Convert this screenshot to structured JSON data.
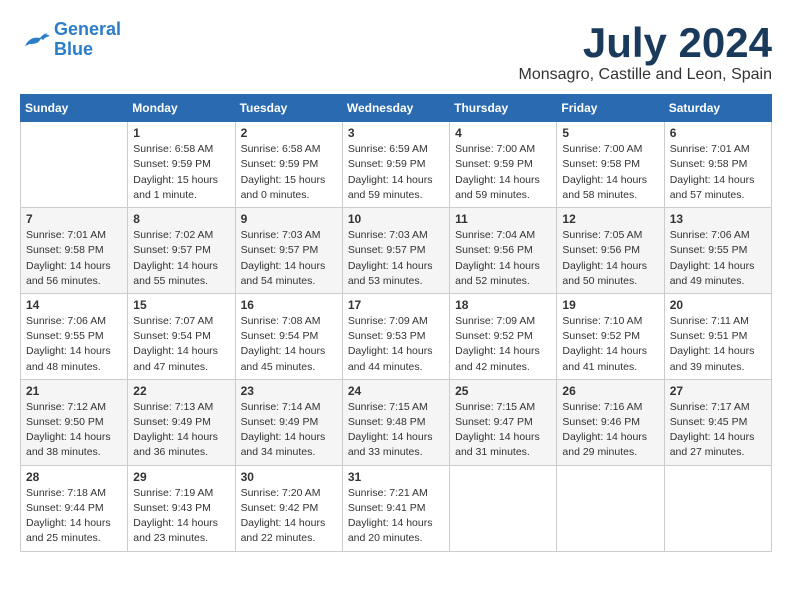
{
  "logo": {
    "line1": "General",
    "line2": "Blue"
  },
  "title": "July 2024",
  "location": "Monsagro, Castille and Leon, Spain",
  "weekdays": [
    "Sunday",
    "Monday",
    "Tuesday",
    "Wednesday",
    "Thursday",
    "Friday",
    "Saturday"
  ],
  "weeks": [
    [
      {
        "day": "",
        "info": ""
      },
      {
        "day": "1",
        "info": "Sunrise: 6:58 AM\nSunset: 9:59 PM\nDaylight: 15 hours\nand 1 minute."
      },
      {
        "day": "2",
        "info": "Sunrise: 6:58 AM\nSunset: 9:59 PM\nDaylight: 15 hours\nand 0 minutes."
      },
      {
        "day": "3",
        "info": "Sunrise: 6:59 AM\nSunset: 9:59 PM\nDaylight: 14 hours\nand 59 minutes."
      },
      {
        "day": "4",
        "info": "Sunrise: 7:00 AM\nSunset: 9:59 PM\nDaylight: 14 hours\nand 59 minutes."
      },
      {
        "day": "5",
        "info": "Sunrise: 7:00 AM\nSunset: 9:58 PM\nDaylight: 14 hours\nand 58 minutes."
      },
      {
        "day": "6",
        "info": "Sunrise: 7:01 AM\nSunset: 9:58 PM\nDaylight: 14 hours\nand 57 minutes."
      }
    ],
    [
      {
        "day": "7",
        "info": "Sunrise: 7:01 AM\nSunset: 9:58 PM\nDaylight: 14 hours\nand 56 minutes."
      },
      {
        "day": "8",
        "info": "Sunrise: 7:02 AM\nSunset: 9:57 PM\nDaylight: 14 hours\nand 55 minutes."
      },
      {
        "day": "9",
        "info": "Sunrise: 7:03 AM\nSunset: 9:57 PM\nDaylight: 14 hours\nand 54 minutes."
      },
      {
        "day": "10",
        "info": "Sunrise: 7:03 AM\nSunset: 9:57 PM\nDaylight: 14 hours\nand 53 minutes."
      },
      {
        "day": "11",
        "info": "Sunrise: 7:04 AM\nSunset: 9:56 PM\nDaylight: 14 hours\nand 52 minutes."
      },
      {
        "day": "12",
        "info": "Sunrise: 7:05 AM\nSunset: 9:56 PM\nDaylight: 14 hours\nand 50 minutes."
      },
      {
        "day": "13",
        "info": "Sunrise: 7:06 AM\nSunset: 9:55 PM\nDaylight: 14 hours\nand 49 minutes."
      }
    ],
    [
      {
        "day": "14",
        "info": "Sunrise: 7:06 AM\nSunset: 9:55 PM\nDaylight: 14 hours\nand 48 minutes."
      },
      {
        "day": "15",
        "info": "Sunrise: 7:07 AM\nSunset: 9:54 PM\nDaylight: 14 hours\nand 47 minutes."
      },
      {
        "day": "16",
        "info": "Sunrise: 7:08 AM\nSunset: 9:54 PM\nDaylight: 14 hours\nand 45 minutes."
      },
      {
        "day": "17",
        "info": "Sunrise: 7:09 AM\nSunset: 9:53 PM\nDaylight: 14 hours\nand 44 minutes."
      },
      {
        "day": "18",
        "info": "Sunrise: 7:09 AM\nSunset: 9:52 PM\nDaylight: 14 hours\nand 42 minutes."
      },
      {
        "day": "19",
        "info": "Sunrise: 7:10 AM\nSunset: 9:52 PM\nDaylight: 14 hours\nand 41 minutes."
      },
      {
        "day": "20",
        "info": "Sunrise: 7:11 AM\nSunset: 9:51 PM\nDaylight: 14 hours\nand 39 minutes."
      }
    ],
    [
      {
        "day": "21",
        "info": "Sunrise: 7:12 AM\nSunset: 9:50 PM\nDaylight: 14 hours\nand 38 minutes."
      },
      {
        "day": "22",
        "info": "Sunrise: 7:13 AM\nSunset: 9:49 PM\nDaylight: 14 hours\nand 36 minutes."
      },
      {
        "day": "23",
        "info": "Sunrise: 7:14 AM\nSunset: 9:49 PM\nDaylight: 14 hours\nand 34 minutes."
      },
      {
        "day": "24",
        "info": "Sunrise: 7:15 AM\nSunset: 9:48 PM\nDaylight: 14 hours\nand 33 minutes."
      },
      {
        "day": "25",
        "info": "Sunrise: 7:15 AM\nSunset: 9:47 PM\nDaylight: 14 hours\nand 31 minutes."
      },
      {
        "day": "26",
        "info": "Sunrise: 7:16 AM\nSunset: 9:46 PM\nDaylight: 14 hours\nand 29 minutes."
      },
      {
        "day": "27",
        "info": "Sunrise: 7:17 AM\nSunset: 9:45 PM\nDaylight: 14 hours\nand 27 minutes."
      }
    ],
    [
      {
        "day": "28",
        "info": "Sunrise: 7:18 AM\nSunset: 9:44 PM\nDaylight: 14 hours\nand 25 minutes."
      },
      {
        "day": "29",
        "info": "Sunrise: 7:19 AM\nSunset: 9:43 PM\nDaylight: 14 hours\nand 23 minutes."
      },
      {
        "day": "30",
        "info": "Sunrise: 7:20 AM\nSunset: 9:42 PM\nDaylight: 14 hours\nand 22 minutes."
      },
      {
        "day": "31",
        "info": "Sunrise: 7:21 AM\nSunset: 9:41 PM\nDaylight: 14 hours\nand 20 minutes."
      },
      {
        "day": "",
        "info": ""
      },
      {
        "day": "",
        "info": ""
      },
      {
        "day": "",
        "info": ""
      }
    ]
  ]
}
